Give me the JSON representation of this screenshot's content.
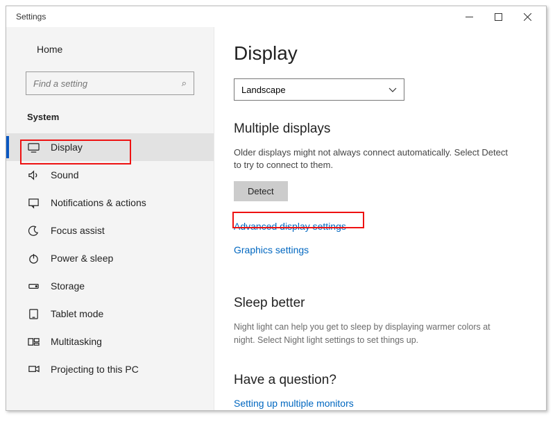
{
  "window": {
    "title": "Settings"
  },
  "sidebar": {
    "home_label": "Home",
    "search_placeholder": "Find a setting",
    "category_label": "System",
    "items": [
      {
        "label": "Display"
      },
      {
        "label": "Sound"
      },
      {
        "label": "Notifications & actions"
      },
      {
        "label": "Focus assist"
      },
      {
        "label": "Power & sleep"
      },
      {
        "label": "Storage"
      },
      {
        "label": "Tablet mode"
      },
      {
        "label": "Multitasking"
      },
      {
        "label": "Projecting to this PC"
      }
    ]
  },
  "main": {
    "page_title": "Display",
    "orientation_selected": "Landscape",
    "multiple_displays": {
      "heading": "Multiple displays",
      "body": "Older displays might not always connect automatically. Select Detect to try to connect to them.",
      "detect_label": "Detect",
      "advanced_link": "Advanced display settings",
      "graphics_link": "Graphics settings"
    },
    "sleep_better": {
      "heading": "Sleep better",
      "body": "Night light can help you get to sleep by displaying warmer colors at night. Select Night light settings to set things up."
    },
    "question": {
      "heading": "Have a question?",
      "link": "Setting up multiple monitors"
    }
  }
}
